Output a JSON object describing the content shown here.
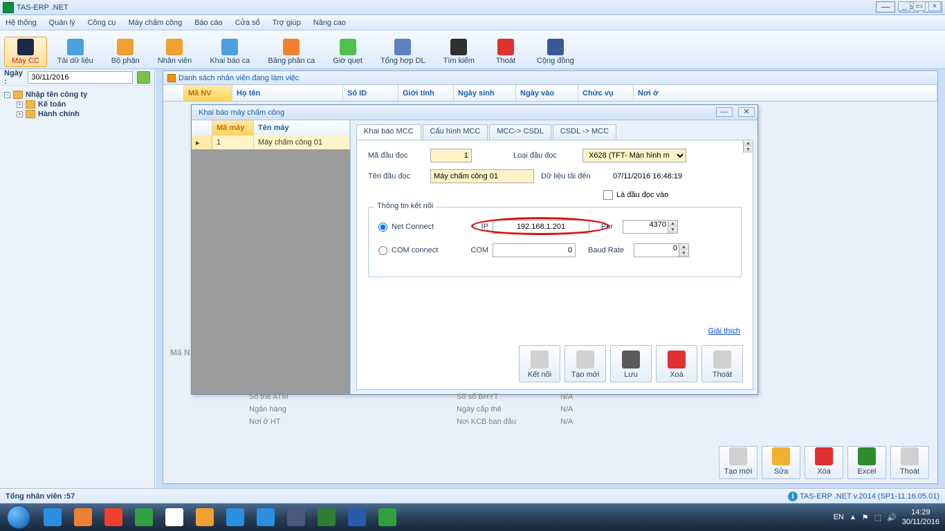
{
  "app": {
    "title": "TAS-ERP .NET"
  },
  "menu": [
    "Hệ thống",
    "Quản lý",
    "Công cụ",
    "Máy chấm công",
    "Báo cáo",
    "Cửa sổ",
    "Trợ giúp",
    "Nâng cao"
  ],
  "toolbar": [
    {
      "label": "Máy CC",
      "color": "#1a2a4a",
      "active": true
    },
    {
      "label": "Tải dữ liệu",
      "color": "#4aa0e0"
    },
    {
      "label": "Bộ phận",
      "color": "#f0a030"
    },
    {
      "label": "Nhân viên",
      "color": "#f0a030"
    },
    {
      "label": "Khai báo ca",
      "color": "#4aa0e0"
    },
    {
      "label": "Bảng phân ca",
      "color": "#f08030"
    },
    {
      "label": "Giờ quẹt",
      "color": "#50c050"
    },
    {
      "label": "Tổng hợp DL",
      "color": "#6080c0"
    },
    {
      "label": "Tìm kiếm",
      "color": "#303030"
    },
    {
      "label": "Thoát",
      "color": "#e03030"
    },
    {
      "label": "Cộng đồng",
      "color": "#3b5998"
    }
  ],
  "date": {
    "label": "Ngày :",
    "value": "30/11/2016"
  },
  "tree": {
    "root": "Nhập tên công ty",
    "children": [
      {
        "label": "Kế toán"
      },
      {
        "label": "Hành chính"
      }
    ]
  },
  "doc": {
    "title": "Danh sách nhân viên đang làm việc",
    "columns": [
      "",
      "Mã NV",
      "Họ tên",
      "Số ID",
      "Giới tính",
      "Ngày sinh",
      "Ngày vào",
      "Chức vụ",
      "Nơi ở"
    ]
  },
  "bg_label": "Mã N",
  "modal": {
    "title": "Khai báo máy chấm công",
    "list": {
      "head": [
        "",
        "Mã máy",
        "Tên máy"
      ],
      "row": [
        "",
        "1",
        "Máy chấm công 01"
      ]
    },
    "tabs": [
      "Khai báo MCC",
      "Cấu hình MCC",
      "MCC-> CSDL",
      "CSDL -> MCC"
    ],
    "form": {
      "reader_id_label": "Mã đầu đọc",
      "reader_id": "1",
      "reader_type_label": "Loại đầu đọc",
      "reader_type": "X628 (TFT- Màn hình m",
      "reader_name_label": "Tên đầu đọc",
      "reader_name": "Máy chấm công 01",
      "data_until_label": "Dữ liệu tải đến",
      "data_until": "07/11/2016 16:48:19",
      "is_in_reader": "Là đầu đọc vào",
      "conn_legend": "Thông tin kết nối",
      "net_connect": "Net Connect",
      "ip_label": "IP",
      "ip": "192.168.1.201",
      "port_label": "Por",
      "port": "4370",
      "com_connect": "COM connect",
      "com_label": "COM",
      "com": "0",
      "baud_label": "Baud Rate",
      "baud": "0",
      "explain": "Giải thích",
      "buttons": [
        "Kết nối",
        "Tạo mới",
        "Lưu",
        "Xoá",
        "Thoát"
      ],
      "button_colors": [
        "#d0d0d0",
        "#d0d0d0",
        "#5a5a5a",
        "#e03030",
        "#d0d0d0"
      ]
    }
  },
  "info": {
    "rows": [
      [
        "Số thẻ ATM",
        "Số sổ BHYT",
        "N/A"
      ],
      [
        "Ngân hàng",
        "Ngày cấp thẻ",
        "N/A"
      ],
      [
        "Nơi ở HT",
        "Nơi KCB ban đầu",
        "N/A"
      ]
    ]
  },
  "bottom_buttons": [
    {
      "label": "Tạo mới",
      "color": "#d0d0d0"
    },
    {
      "label": "Sửa",
      "color": "#f0b030"
    },
    {
      "label": "Xóa",
      "color": "#e03030"
    },
    {
      "label": "Excel",
      "color": "#2e8b2e"
    },
    {
      "label": "Thoát",
      "color": "#d0d0d0"
    }
  ],
  "status": {
    "left": "Tổng nhân viên :57",
    "right": "TAS-ERP .NET v.2014 (SP1-11.16.05.01)"
  },
  "tray": {
    "lang": "EN",
    "time": "14:29",
    "date": "30/11/2016"
  },
  "task_icons": [
    "#2a8fe0",
    "#f08030",
    "#f04030",
    "#30a040",
    "#ffffff",
    "#f0a030",
    "#2a8fe0",
    "#2a8fe0",
    "#4a5a7a",
    "#2e7d32",
    "#2a5aaa",
    "#30a040"
  ]
}
